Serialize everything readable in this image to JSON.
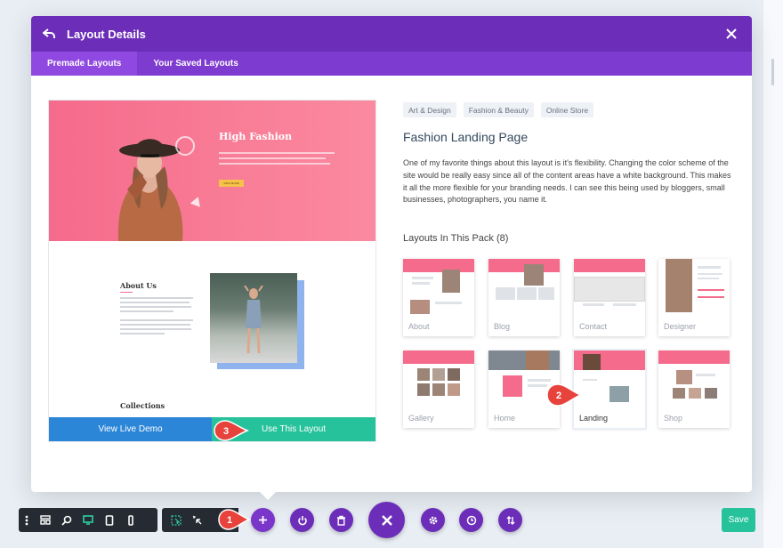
{
  "modal": {
    "title": "Layout Details",
    "tabs": [
      {
        "label": "Premade Layouts",
        "active": true
      },
      {
        "label": "Your Saved Layouts",
        "active": false
      }
    ]
  },
  "preview": {
    "hero_title": "High Fashion",
    "hero_button": "VIEW MORE",
    "about_title": "About Us",
    "collections_title": "Collections",
    "view_demo_label": "View Live Demo",
    "use_layout_label": "Use This Layout"
  },
  "details": {
    "tags": [
      "Art & Design",
      "Fashion & Beauty",
      "Online Store"
    ],
    "layout_title": "Fashion Landing Page",
    "description": "One of my favorite things about this layout is it's flexibility. Changing the color scheme of the site would be really easy since all of the content areas have a white background. This makes it all the more flexible for your branding needs. I can see this being used by bloggers, small businesses, photographers, you name it.",
    "pack_heading": "Layouts In This Pack (8)",
    "pack": [
      {
        "label": "About",
        "selected": false
      },
      {
        "label": "Blog",
        "selected": false
      },
      {
        "label": "Contact",
        "selected": false
      },
      {
        "label": "Designer",
        "selected": false
      },
      {
        "label": "Gallery",
        "selected": false
      },
      {
        "label": "Home",
        "selected": false
      },
      {
        "label": "Landing",
        "selected": true
      },
      {
        "label": "Shop",
        "selected": false
      }
    ]
  },
  "callouts": [
    "1",
    "2",
    "3"
  ],
  "toolbar": {
    "save_label": "Save"
  },
  "colors": {
    "header_purple": "#6c2eb9",
    "tab_purple": "#7e3bd0",
    "accent_pink": "#f56b8b",
    "demo_blue": "#2c86d8",
    "use_green": "#26c29b",
    "callout_red": "#e8423c"
  }
}
